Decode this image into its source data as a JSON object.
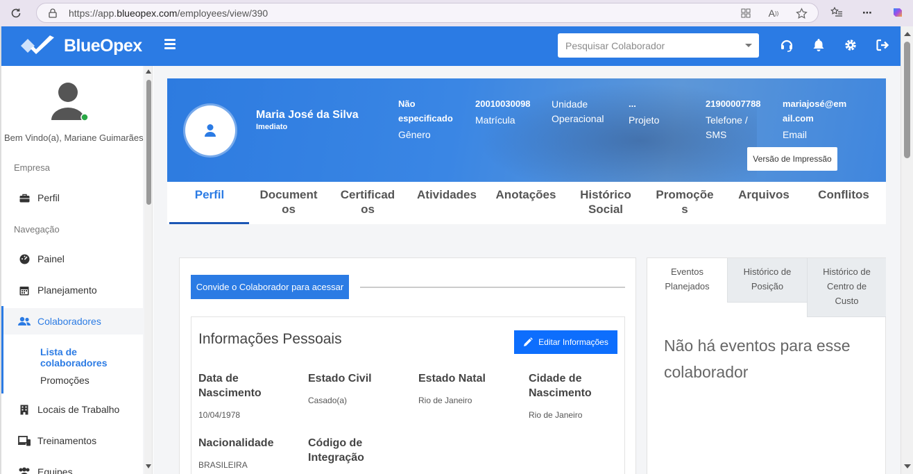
{
  "browser": {
    "url_prefix": "https://app.",
    "url_host": "blueopex.com",
    "url_path": "/employees/view/390"
  },
  "topbar": {
    "brand": "BlueOpex",
    "search_placeholder": "Pesquisar Colaborador",
    "accent": "#2b7be4"
  },
  "sidebar": {
    "welcome": "Bem Vindo(a), Mariane Guimarães",
    "section_company": "Empresa",
    "section_nav": "Navegação",
    "items": {
      "perfil": "Perfil",
      "painel": "Painel",
      "planejamento": "Planejamento",
      "colaboradores": "Colaboradores",
      "lista": "Lista de colaboradores",
      "promocoes": "Promoções",
      "locais": "Locais de Trabalho",
      "treinamentos": "Treinamentos",
      "equipes": "Equipes"
    }
  },
  "employee": {
    "name": "Maria José da Silva",
    "role": "Imediato",
    "gender_value_1": "Não",
    "gender_value_2": "especificado",
    "gender_label": "Gênero",
    "registration_value": "20010030098",
    "registration_label": "Matrícula",
    "unit_label_1": "Unidade",
    "unit_label_2": "Operacional",
    "project_value": "...",
    "project_label": "Projeto",
    "phone_value": "21900007788",
    "phone_label_1": "Telefone /",
    "phone_label_2": "SMS",
    "email_value_1": "mariajosé@em",
    "email_value_2": "ail.com",
    "email_label": "Email",
    "print_button": "Versão de Impressão"
  },
  "tabs": {
    "perfil": "Perfil",
    "documentos_1": "Document",
    "documentos_2": "os",
    "certificados_1": "Certificad",
    "certificados_2": "os",
    "atividades": "Atividades",
    "anotacoes": "Anotações",
    "historico_1": "Histórico",
    "historico_2": "Social",
    "promocoes_1": "Promoçõe",
    "promocoes_2": "s",
    "arquivos": "Arquivos",
    "conflitos": "Conflitos"
  },
  "personal": {
    "invite_button": "Convide o Colaborador para acessar",
    "title": "Informações Pessoais",
    "edit_button": "Editar Informações",
    "birth_date_label_1": "Data de",
    "birth_date_label_2": "Nascimento",
    "birth_date": "10/04/1978",
    "civil_label": "Estado Civil",
    "civil": "Casado(a)",
    "native_state_label": "Estado Natal",
    "native_state": "Rio de Janeiro",
    "birth_city_label_1": "Cidade de",
    "birth_city_label_2": "Nascimento",
    "birth_city": "Rio de Janeiro",
    "nationality_label": "Nacionalidade",
    "nationality": "BRASILEIRA",
    "integration_label_1": "Código de",
    "integration_label_2": "Integração"
  },
  "events": {
    "tab1_1": "Eventos",
    "tab1_2": "Planejados",
    "tab2_1": "Histórico de",
    "tab2_2": "Posição",
    "tab3_1": "Histórico de",
    "tab3_2": "Centro de",
    "tab3_3": "Custo",
    "empty_1": "Não há eventos para esse",
    "empty_2": "colaborador"
  }
}
